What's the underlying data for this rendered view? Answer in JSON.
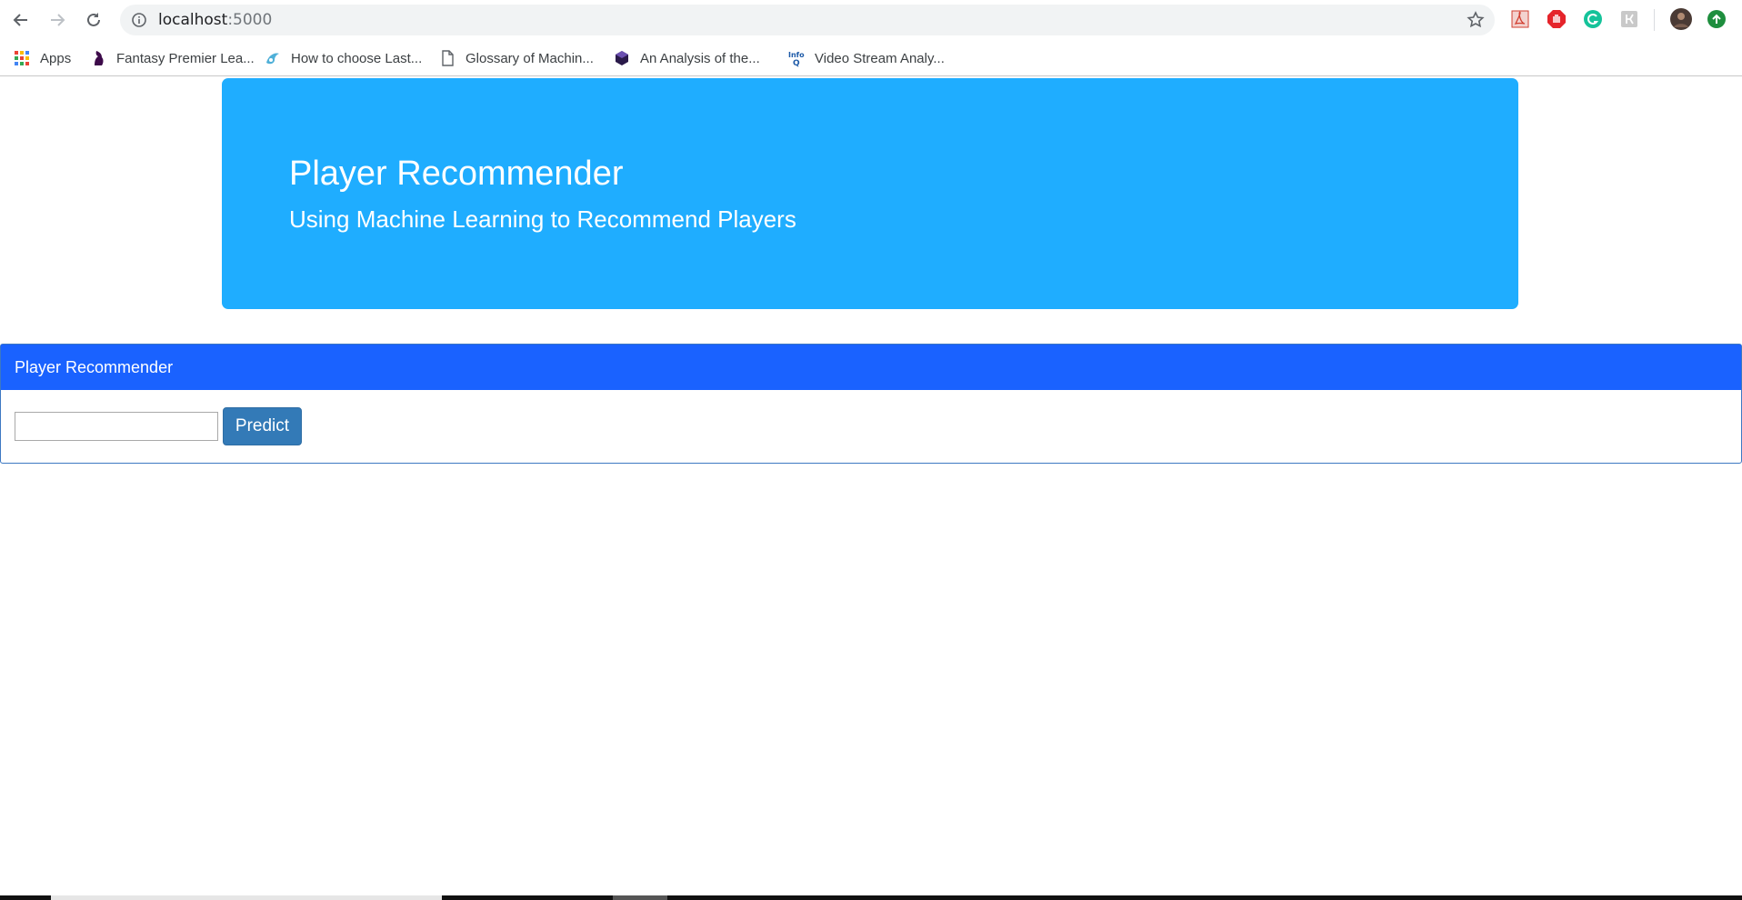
{
  "browser": {
    "url_host": "localhost",
    "url_port": ":5000",
    "bookmarks": [
      {
        "label": "Apps",
        "icon": "apps-grid-icon"
      },
      {
        "label": "Fantasy Premier Lea...",
        "icon": "premier-league-icon"
      },
      {
        "label": "How to choose Last...",
        "icon": "bookmark-site-icon"
      },
      {
        "label": "Glossary of Machin...",
        "icon": "page-icon"
      },
      {
        "label": "An Analysis of the...",
        "icon": "hexagon-icon"
      },
      {
        "label": "Video Stream Analy...",
        "icon": "infoq-icon"
      }
    ],
    "extensions": [
      "pdf-icon",
      "adblock-icon",
      "grammarly-icon",
      "extension-icon",
      "profile-avatar",
      "update-icon"
    ]
  },
  "jumbotron": {
    "title": "Player Recommender",
    "subtitle": "Using Machine Learning to Recommend Players",
    "color": "#1fadff"
  },
  "panel": {
    "heading": "Player Recommender",
    "input_value": "",
    "button_label": "Predict",
    "heading_color": "#1a62ff",
    "button_color": "#337ab7"
  }
}
